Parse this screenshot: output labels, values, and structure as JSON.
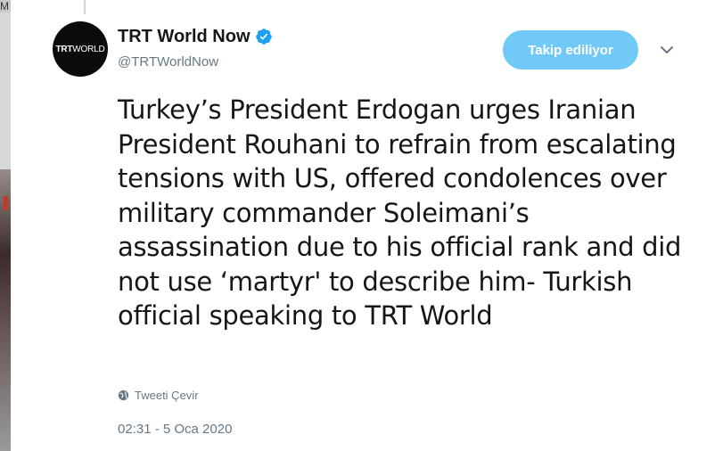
{
  "edge": {
    "letter": "M"
  },
  "avatar": {
    "brand_a": "TRT",
    "brand_b": "WORLD"
  },
  "author": {
    "display_name": "TRT World Now",
    "handle": "@TRTWorldNow",
    "verified": true
  },
  "actions": {
    "follow_label": "Takip ediliyor",
    "caret_icon": "chevron-down-icon"
  },
  "tweet": {
    "text": "Turkey’s President Erdogan urges Iranian President Rouhani to refrain from escalating tensions with US, offered condolences over military commander Soleimani’s assassination due to his official rank and did not use ‘martyr' to describe him- Turkish official speaking to TRT World",
    "translate_label": "Tweeti Çevir",
    "translate_icon": "globe-icon",
    "timestamp": "02:31 - 5 Oca 2020"
  },
  "colors": {
    "follow_button": "#71c9f8",
    "verified": "#1da1f2",
    "secondary_text": "#657786",
    "primary_text": "#14171a"
  }
}
